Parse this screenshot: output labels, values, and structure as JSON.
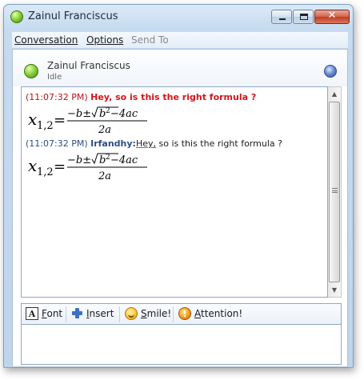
{
  "window": {
    "title": "Zainul Franciscus",
    "app_icon": "green-status-orb-icon",
    "controls": {
      "minimize_icon": "minimize-icon",
      "maximize_icon": "maximize-icon",
      "close_icon": "close-icon",
      "close_glyph": "✕"
    }
  },
  "menu": {
    "items": [
      {
        "label": "Conversation",
        "enabled": true
      },
      {
        "label": "Options",
        "enabled": true
      },
      {
        "label": "Send To",
        "enabled": false
      }
    ]
  },
  "contact": {
    "name": "Zainul Franciscus",
    "status": "Idle",
    "status_icon": "green-status-orb-icon",
    "action_icon": "globe-icon"
  },
  "messages": [
    {
      "time": "(11:07:32 PM)",
      "sender": "",
      "text": "Hey, so is this the right formula ?",
      "style": "red-bold",
      "formula": {
        "lhs": "x",
        "subscript": "1,2",
        "numerator": "−b±√b²−4ac",
        "num_minus_b": "−b±",
        "num_radicand": "b",
        "num_sup": "2",
        "num_rest": "−4ac",
        "denominator": "2a"
      }
    },
    {
      "time": "(11:07:32 PM)",
      "sender": "Irfandhy:",
      "text_prefix": "Hey,",
      "text_rest": " so is this the right formula ?",
      "style": "black",
      "formula": {
        "lhs": "x",
        "subscript": "1,2",
        "numerator": "−b±√b²−4ac",
        "num_minus_b": "−b±",
        "num_radicand": "b",
        "num_sup": "2",
        "num_rest": "−4ac",
        "denominator": "2a"
      }
    }
  ],
  "toolbar": {
    "buttons": [
      {
        "label": "Font",
        "icon": "font-icon",
        "glyph": "A"
      },
      {
        "label": "Insert",
        "icon": "insert-plus-icon"
      },
      {
        "label": "Smile!",
        "icon": "smiley-icon"
      },
      {
        "label": "Attention!",
        "icon": "attention-icon",
        "glyph": "!"
      }
    ]
  },
  "input": {
    "value": ""
  },
  "colors": {
    "accent_red": "#d3151b",
    "accent_blue": "#2b4d86",
    "frame_blue": "#bfd5ec"
  }
}
